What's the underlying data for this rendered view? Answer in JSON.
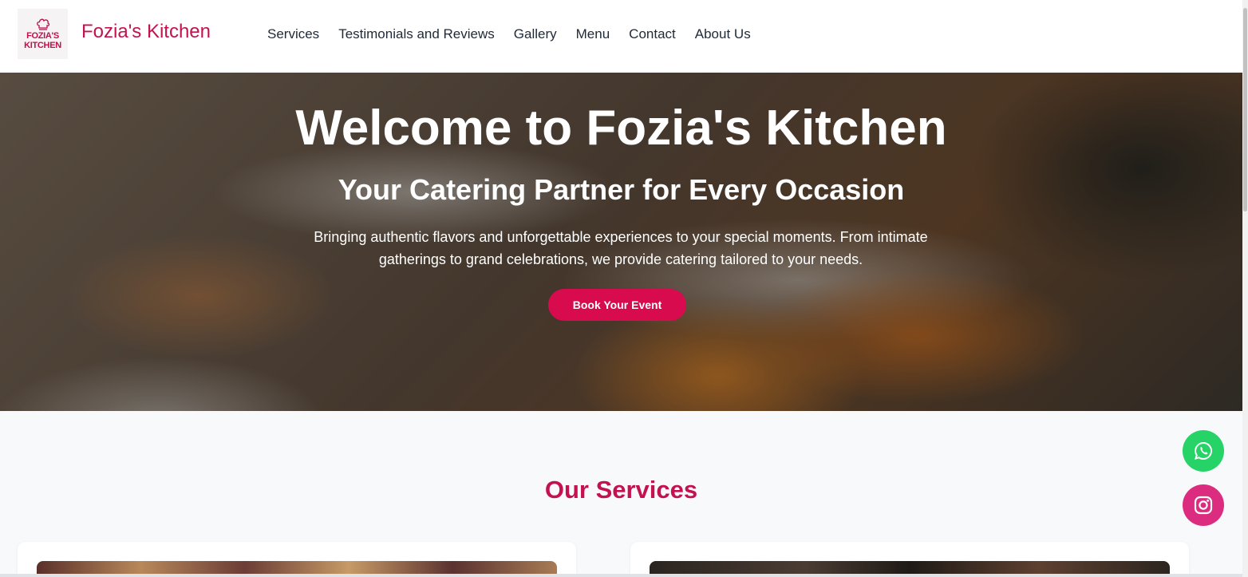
{
  "header": {
    "logo_line1": "FOZIA'S",
    "logo_line2": "KITCHEN",
    "brand": "Fozia's Kitchen",
    "nav": [
      "Services",
      "Testimonials and Reviews",
      "Gallery",
      "Menu",
      "Contact",
      "About Us"
    ]
  },
  "hero": {
    "title": "Welcome to Fozia's Kitchen",
    "subtitle": "Your Catering Partner for Every Occasion",
    "description": "Bringing authentic flavors and unforgettable experiences to your special moments. From intimate gatherings to grand celebrations, we provide catering tailored to your needs.",
    "cta": "Book Your Event"
  },
  "services": {
    "title": "Our Services"
  },
  "icons": {
    "logo": "chef-hat-icon",
    "whatsapp": "whatsapp-icon",
    "instagram": "instagram-icon"
  },
  "colors": {
    "brand": "#c4124f",
    "cta": "#d90b4f",
    "whatsapp": "#25d366",
    "instagram": "#dc2c7f"
  }
}
